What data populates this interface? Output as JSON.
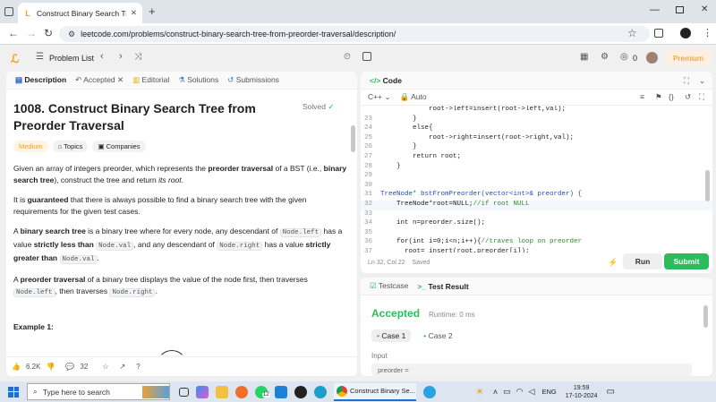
{
  "browser": {
    "tab_title": "Construct Binary Search Tree from Preorder Traversal - LeetCode",
    "url": "leetcode.com/problems/construct-binary-search-tree-from-preorder-traversal/description/"
  },
  "leetcode_header": {
    "problem_list": "Problem List",
    "premium": "Premium",
    "streak": "0"
  },
  "left_tabs": [
    {
      "label": "Description"
    },
    {
      "label": "Accepted"
    },
    {
      "label": "Editorial"
    },
    {
      "label": "Solutions"
    },
    {
      "label": "Submissions"
    }
  ],
  "problem": {
    "title": "1008. Construct Binary Search Tree from Preorder Traversal",
    "status": "Solved",
    "difficulty": "Medium",
    "topics": "Topics",
    "companies": "Companies",
    "p1_a": "Given an array of integers preorder, which represents the ",
    "p1_b": "preorder traversal",
    "p1_c": " of a BST (i.e., ",
    "p1_d": "binary search tree",
    "p1_e": "), construct the tree and return ",
    "p1_f": "its root",
    "p1_g": ".",
    "p2_a": "It is ",
    "p2_b": "guaranteed",
    "p2_c": " that there is always possible to find a binary search tree with the given requirements for the given test cases.",
    "p3_a": "A ",
    "p3_b": "binary search tree",
    "p3_c": " is a binary tree where for every node, any descendant of ",
    "p3_code1": "Node.left",
    "p3_d": " has a value ",
    "p3_e": "strictly less than",
    "p3_code2": "Node.val",
    "p3_f": ", and any descendant of ",
    "p3_code3": "Node.right",
    "p3_g": " has a value ",
    "p3_h": "strictly greater than",
    "p3_code4": "Node.val",
    "p3_i": ".",
    "p4_a": "A ",
    "p4_b": "preorder traversal",
    "p4_c": " of a binary tree displays the value of the node first, then traverses ",
    "p4_code1": "Node.left",
    "p4_d": ", then traverses ",
    "p4_code2": "Node.right",
    "p4_e": ".",
    "example": "Example 1:"
  },
  "bottom_stats": {
    "likes": "6.2K",
    "comments": "32"
  },
  "code_panel": {
    "title": "Code",
    "language": "C++",
    "mode": "Auto",
    "status": "Ln 32, Col 22",
    "saved": "Saved",
    "run": "Run",
    "submit": "Submit",
    "lines": [
      {
        "n": "",
        "t": "            root->left=insert(root->left,val);",
        "cls": ""
      },
      {
        "n": "23",
        "t": "        }",
        "cls": ""
      },
      {
        "n": "24",
        "t": "        else{",
        "cls": ""
      },
      {
        "n": "25",
        "t": "            root->right=insert(root->right,val);",
        "cls": ""
      },
      {
        "n": "26",
        "t": "        }",
        "cls": ""
      },
      {
        "n": "27",
        "t": "        return root;",
        "cls": ""
      },
      {
        "n": "28",
        "t": "    }",
        "cls": ""
      },
      {
        "n": "29",
        "t": "",
        "cls": ""
      },
      {
        "n": "30",
        "t": "",
        "cls": ""
      },
      {
        "n": "31",
        "t": "TreeNode* bstFromPreorder(vector<int>& preorder) {",
        "cls": "kw"
      },
      {
        "n": "32",
        "t": "    TreeNode*root=NULL;//if root NULL",
        "cls": ""
      },
      {
        "n": "33",
        "t": "",
        "cls": ""
      },
      {
        "n": "34",
        "t": "    int n=preorder.size();",
        "cls": ""
      },
      {
        "n": "35",
        "t": "",
        "cls": ""
      },
      {
        "n": "36",
        "t": "    for(int i=0;i<n;i++){//traves loop on preorder",
        "cls": ""
      },
      {
        "n": "37",
        "t": "      root= insert(root,preorder[i]);",
        "cls": ""
      }
    ]
  },
  "test_panel": {
    "tab_testcase": "Testcase",
    "tab_result": "Test Result",
    "verdict": "Accepted",
    "runtime": "Runtime: 0 ms",
    "case1": "Case 1",
    "case2": "Case 2",
    "input_label": "Input",
    "input_value": "preorder ="
  },
  "taskbar": {
    "search_placeholder": "Type here to search",
    "chrome_label": "Construct Binary Se...",
    "lang": "ENG",
    "time": "19:59",
    "date": "17-10-2024",
    "whatsapp_badge": "12"
  }
}
